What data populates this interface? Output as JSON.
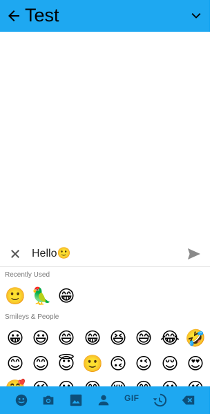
{
  "header": {
    "title": "Test",
    "bg_color": "#1ea8f1"
  },
  "composer": {
    "value": "Hello🙂",
    "close_icon": "close-icon",
    "send_icon": "send-icon"
  },
  "recently_used": {
    "label": "Recently Used",
    "emojis": [
      "🙂",
      "🦜",
      "😁"
    ]
  },
  "smileys": {
    "label": "Smileys & People",
    "row1": [
      "😀",
      "😃",
      "😄",
      "😁",
      "😆",
      "😅",
      "😂",
      "🤣"
    ],
    "row2": [
      "😊",
      "😊",
      "😇",
      "🙂",
      "🙃",
      "😉",
      "😌",
      "😍"
    ],
    "row3_partial": [
      "🥰",
      "😘",
      "😗",
      "😙",
      "😚",
      "😋",
      "😛",
      "😜"
    ]
  },
  "bottom_tabs": {
    "emoji": "emoji-tab-icon",
    "camera": "camera-icon",
    "gallery": "image-icon",
    "contact": "person-icon",
    "gif": "GIF",
    "recent": "history-icon",
    "delete": "backspace-icon"
  }
}
